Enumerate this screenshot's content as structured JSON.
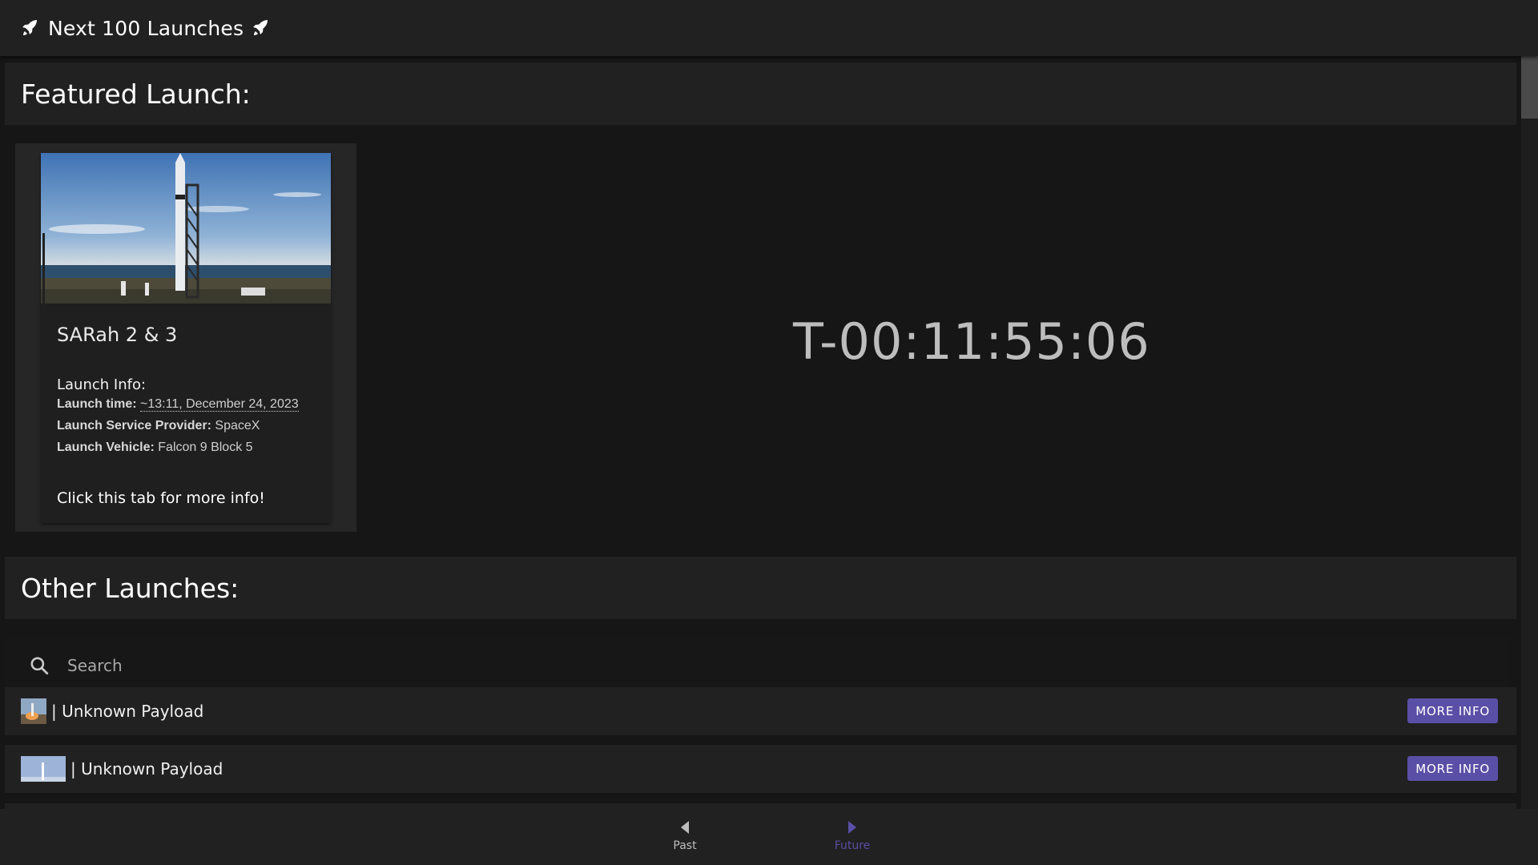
{
  "app": {
    "title": "Next 100 Launches"
  },
  "featured": {
    "heading": "Featured Launch:",
    "name": "SARah 2 & 3",
    "info_heading": "Launch Info:",
    "launch_time_label": "Launch time:",
    "launch_time_value": "~13:11, December 24, 2023",
    "provider_label": "Launch Service Provider:",
    "provider_value": "SpaceX",
    "vehicle_label": "Launch Vehicle:",
    "vehicle_value": "Falcon 9 Block 5",
    "cta": "Click this tab for more info!",
    "countdown": "T-00:11:55:06"
  },
  "other": {
    "heading": "Other Launches:",
    "search_placeholder": "Search",
    "rows": [
      {
        "label": "| Unknown Payload",
        "button": "MORE INFO"
      },
      {
        "label": "| Unknown Payload",
        "button": "MORE INFO"
      }
    ]
  },
  "bottom_nav": {
    "past_label": "Past",
    "future_label": "Future",
    "active_color": "#5a4fa6",
    "inactive_color": "#bdbdbd"
  },
  "colors": {
    "accent": "#5a4fa6",
    "background": "#161616",
    "surface": "#212121"
  }
}
